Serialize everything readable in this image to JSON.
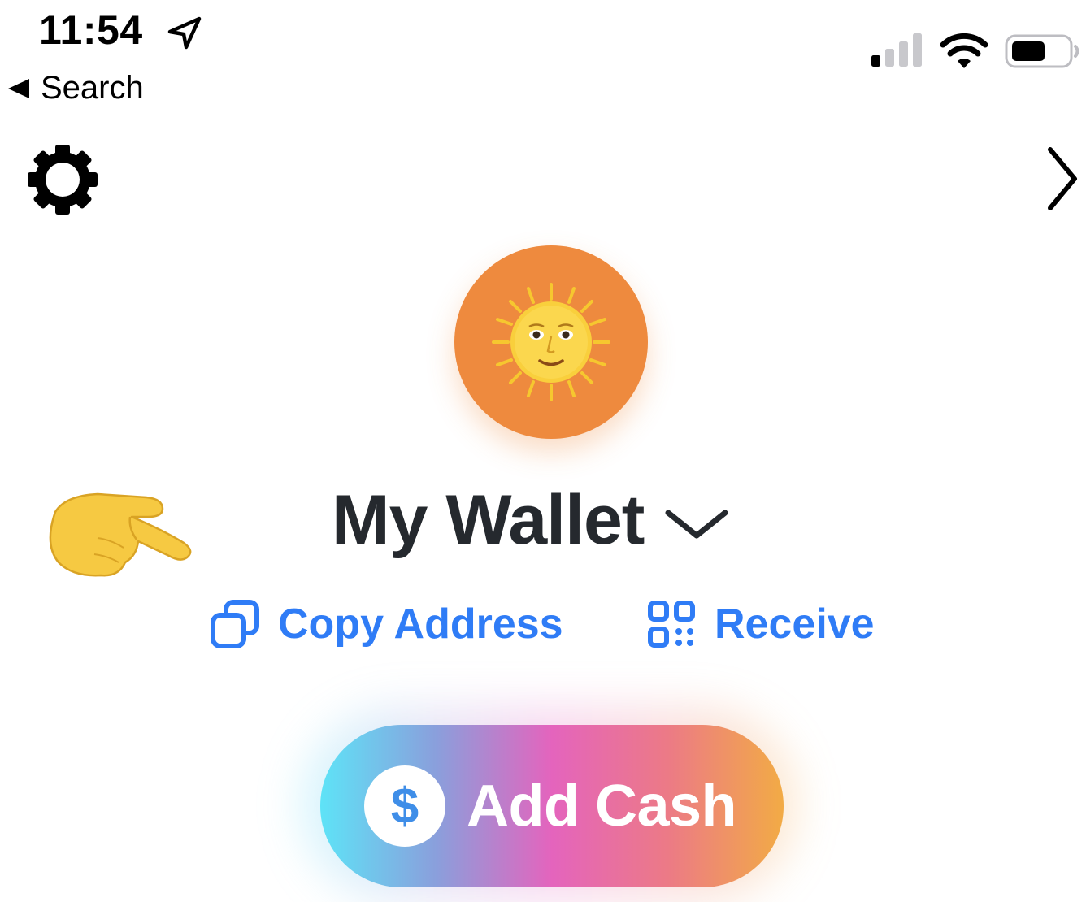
{
  "status_bar": {
    "time": "11:54",
    "back_label": "Search"
  },
  "wallet": {
    "name": "My Wallet"
  },
  "actions": {
    "copy_label": "Copy Address",
    "receive_label": "Receive"
  },
  "add_cash": {
    "label": "Add Cash",
    "icon_symbol": "$"
  },
  "icons": {
    "location": "location-arrow-icon",
    "settings": "gear-icon",
    "next": "chevron-right-icon",
    "avatar": "sun-with-face-emoji",
    "pointer": "backhand-index-pointing-left-emoji",
    "dropdown": "chevron-down-icon",
    "copy": "copy-icon",
    "receive": "qr-code-icon"
  },
  "colors": {
    "accent_blue": "#2f7cf6",
    "avatar_bg": "#ee8a3e",
    "title_text": "#25292e",
    "gradient": [
      "#5ee3f7",
      "#e464bd",
      "#f2ab45"
    ]
  }
}
